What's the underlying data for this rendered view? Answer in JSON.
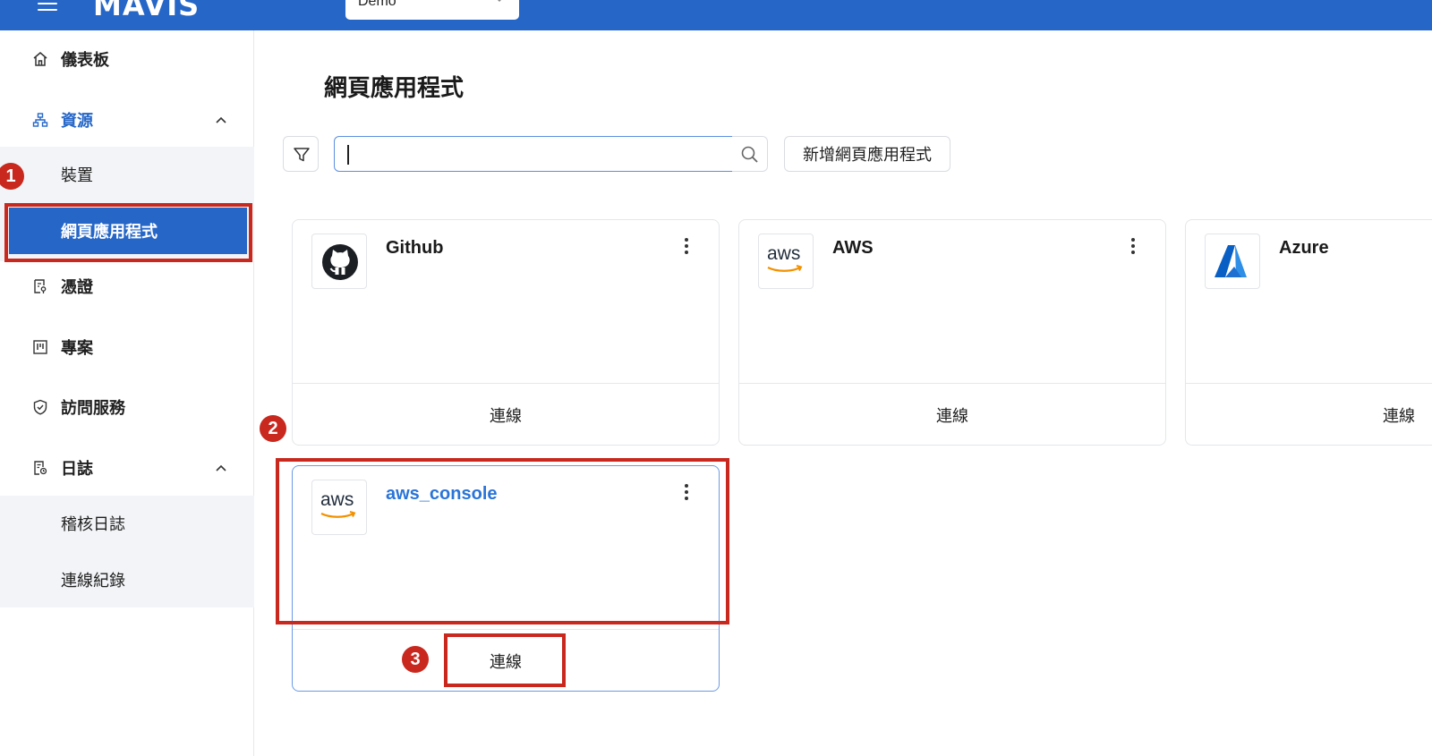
{
  "header": {
    "logo_text": "MAVIS",
    "org_selector_value": "Demo"
  },
  "sidebar": {
    "items": [
      {
        "label": "儀表板",
        "icon": "home-icon"
      },
      {
        "label": "資源",
        "icon": "sitemap-icon",
        "expanded": true
      },
      {
        "label": "裝置"
      },
      {
        "label": "網頁應用程式",
        "selected": true
      },
      {
        "label": "憑證",
        "icon": "credential-icon"
      },
      {
        "label": "專案",
        "icon": "kanban-icon"
      },
      {
        "label": "訪問服務",
        "icon": "shield-check-icon"
      },
      {
        "label": "日誌",
        "icon": "log-icon",
        "expanded": true
      },
      {
        "label": "稽核日誌"
      },
      {
        "label": "連線紀錄"
      }
    ]
  },
  "main": {
    "title": "網頁應用程式",
    "search": {
      "value": "",
      "placeholder": ""
    },
    "add_button_label": "新增網頁應用程式",
    "apps": [
      {
        "name": "Github",
        "logo": "github-logo",
        "action": "連線"
      },
      {
        "name": "AWS",
        "logo": "aws-logo",
        "action": "連線"
      },
      {
        "name": "Azure",
        "logo": "azure-logo",
        "action": "連線"
      },
      {
        "name": "aws_console",
        "logo": "aws-logo",
        "action": "連線",
        "highlighted": true
      }
    ]
  },
  "annotations": {
    "step1": "1",
    "step2": "2",
    "step3": "3"
  },
  "colors": {
    "brand_blue": "#2566c7",
    "annotation_red": "#c8281e",
    "link_blue": "#2a74d8"
  }
}
